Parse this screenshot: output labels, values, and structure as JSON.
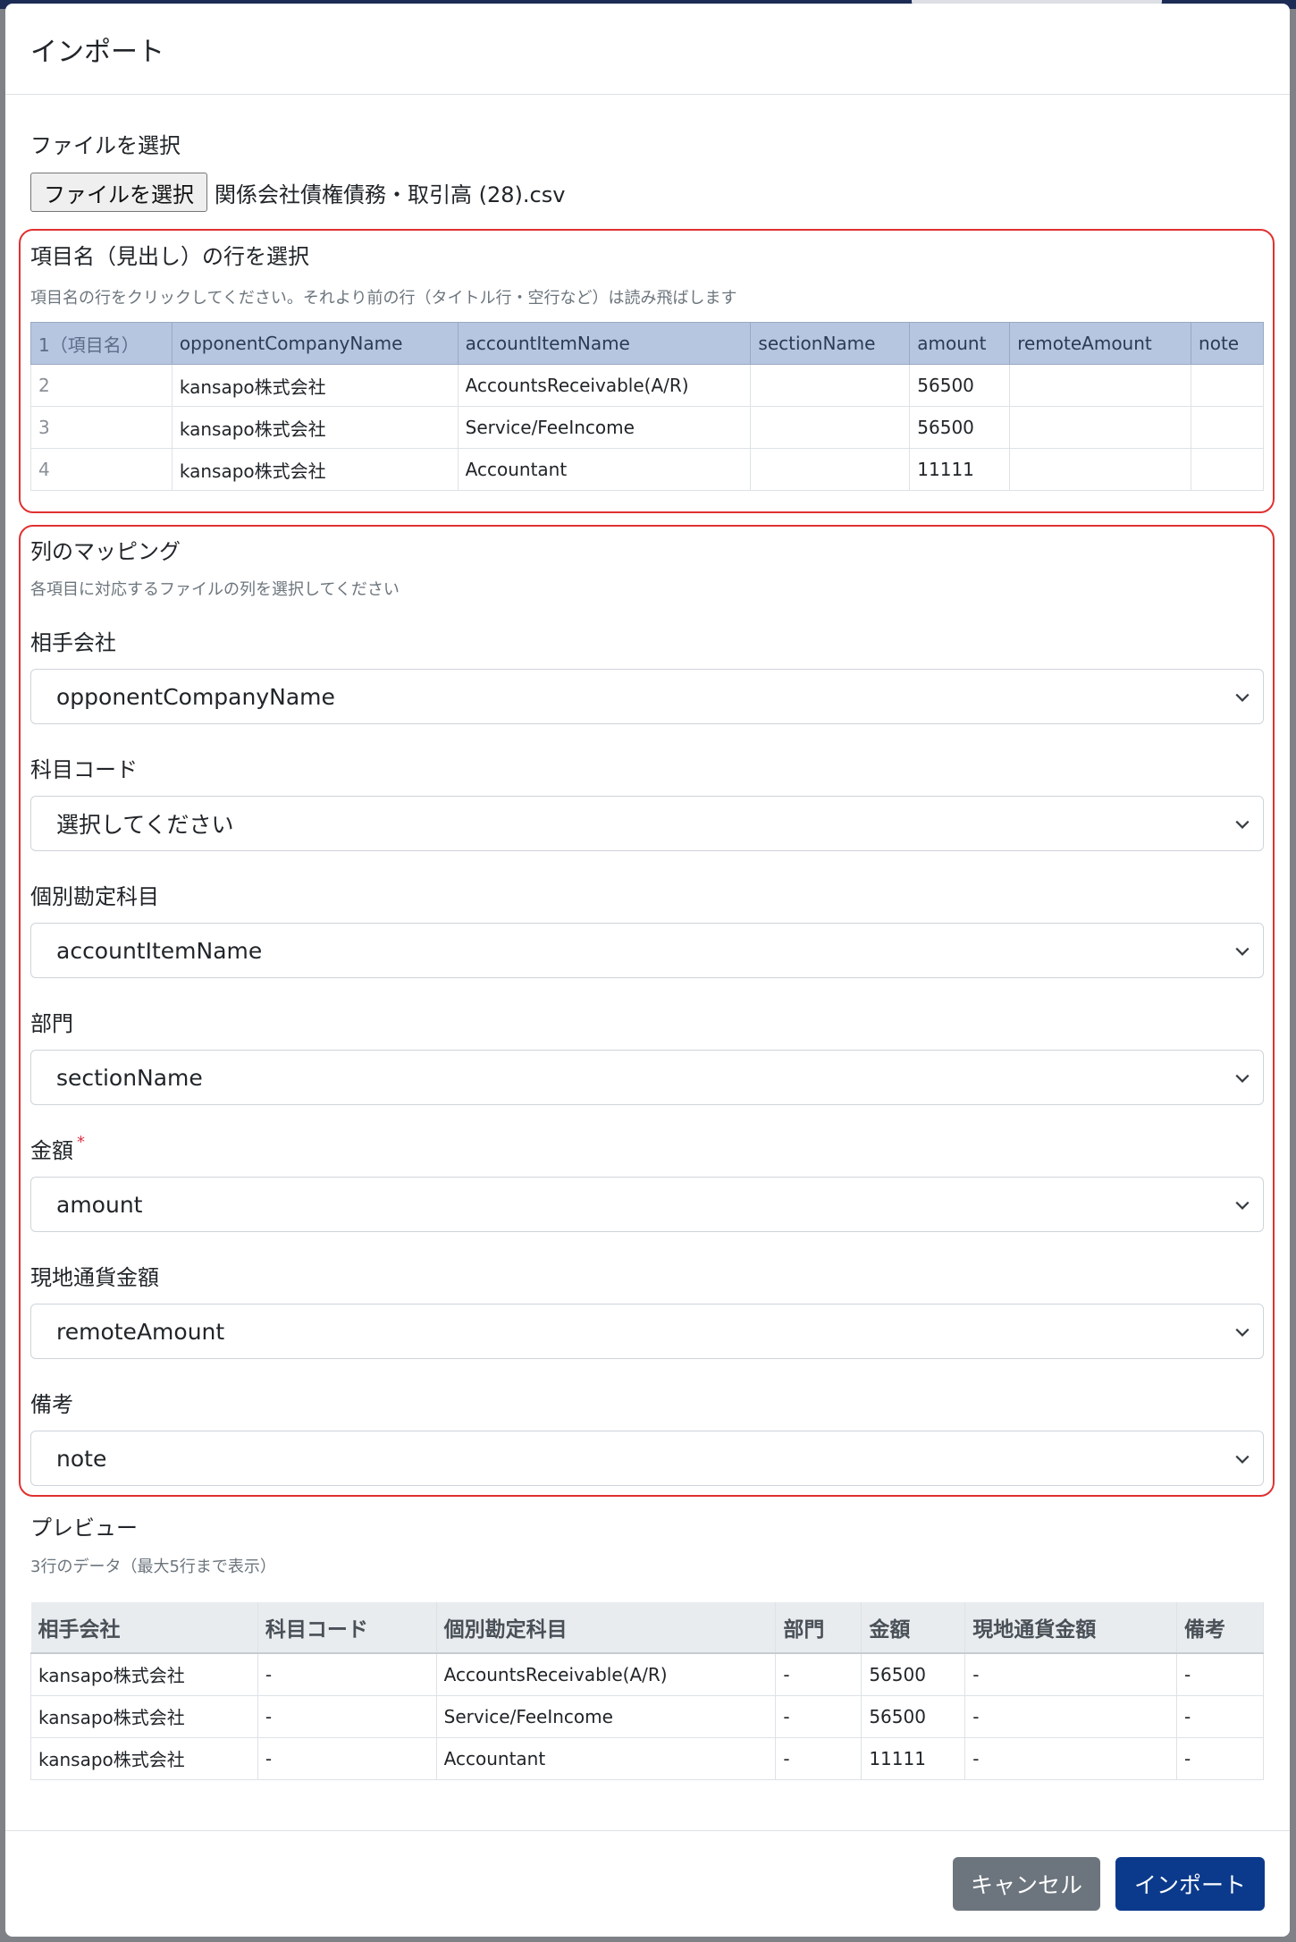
{
  "modal": {
    "title": "インポート"
  },
  "file": {
    "label": "ファイルを選択",
    "button_label": "ファイルを選択",
    "file_name": "関係会社債権債務・取引高 (28).csv"
  },
  "header_row_select": {
    "title": "項目名（見出し）の行を選択",
    "hint": "項目名の行をクリックしてください。それより前の行（タイトル行・空行など）は読み飛ばします",
    "rows": [
      [
        "1（項目名）",
        "opponentCompanyName",
        "accountItemName",
        "sectionName",
        "amount",
        "remoteAmount",
        "note"
      ],
      [
        "2",
        "kansapo株式会社",
        "AccountsReceivable(A/R)",
        "",
        "56500",
        "",
        ""
      ],
      [
        "3",
        "kansapo株式会社",
        "Service/FeeIncome",
        "",
        "56500",
        "",
        ""
      ],
      [
        "4",
        "kansapo株式会社",
        "Accountant",
        "",
        "11111",
        "",
        ""
      ]
    ]
  },
  "mapping": {
    "title": "列のマッピング",
    "hint": "各項目に対応するファイルの列を選択してください",
    "required_mark": "*",
    "fields": [
      {
        "label": "相手会社",
        "value": "opponentCompanyName"
      },
      {
        "label": "科目コード",
        "value": "選択してください"
      },
      {
        "label": "個別勘定科目",
        "value": "accountItemName"
      },
      {
        "label": "部門",
        "value": "sectionName"
      },
      {
        "label": "金額",
        "value": "amount"
      },
      {
        "label": "現地通貨金額",
        "value": "remoteAmount"
      },
      {
        "label": "備考",
        "value": "note"
      }
    ]
  },
  "preview": {
    "title": "プレビュー",
    "hint": "3行のデータ（最大5行まで表示）",
    "columns": [
      "相手会社",
      "科目コード",
      "個別勘定科目",
      "部門",
      "金額",
      "現地通貨金額",
      "備考"
    ],
    "rows": [
      [
        "kansapo株式会社",
        "-",
        "AccountsReceivable(A/R)",
        "-",
        "56500",
        "-",
        "-"
      ],
      [
        "kansapo株式会社",
        "-",
        "Service/FeeIncome",
        "-",
        "56500",
        "-",
        "-"
      ],
      [
        "kansapo株式会社",
        "-",
        "Accountant",
        "-",
        "11111",
        "-",
        "-"
      ]
    ]
  },
  "footer": {
    "cancel_label": "キャンセル",
    "import_label": "インポート"
  },
  "colors": {
    "accent": "#0b3a8c",
    "highlight_border": "#e03131",
    "selected_row": "#b7c6e0"
  }
}
